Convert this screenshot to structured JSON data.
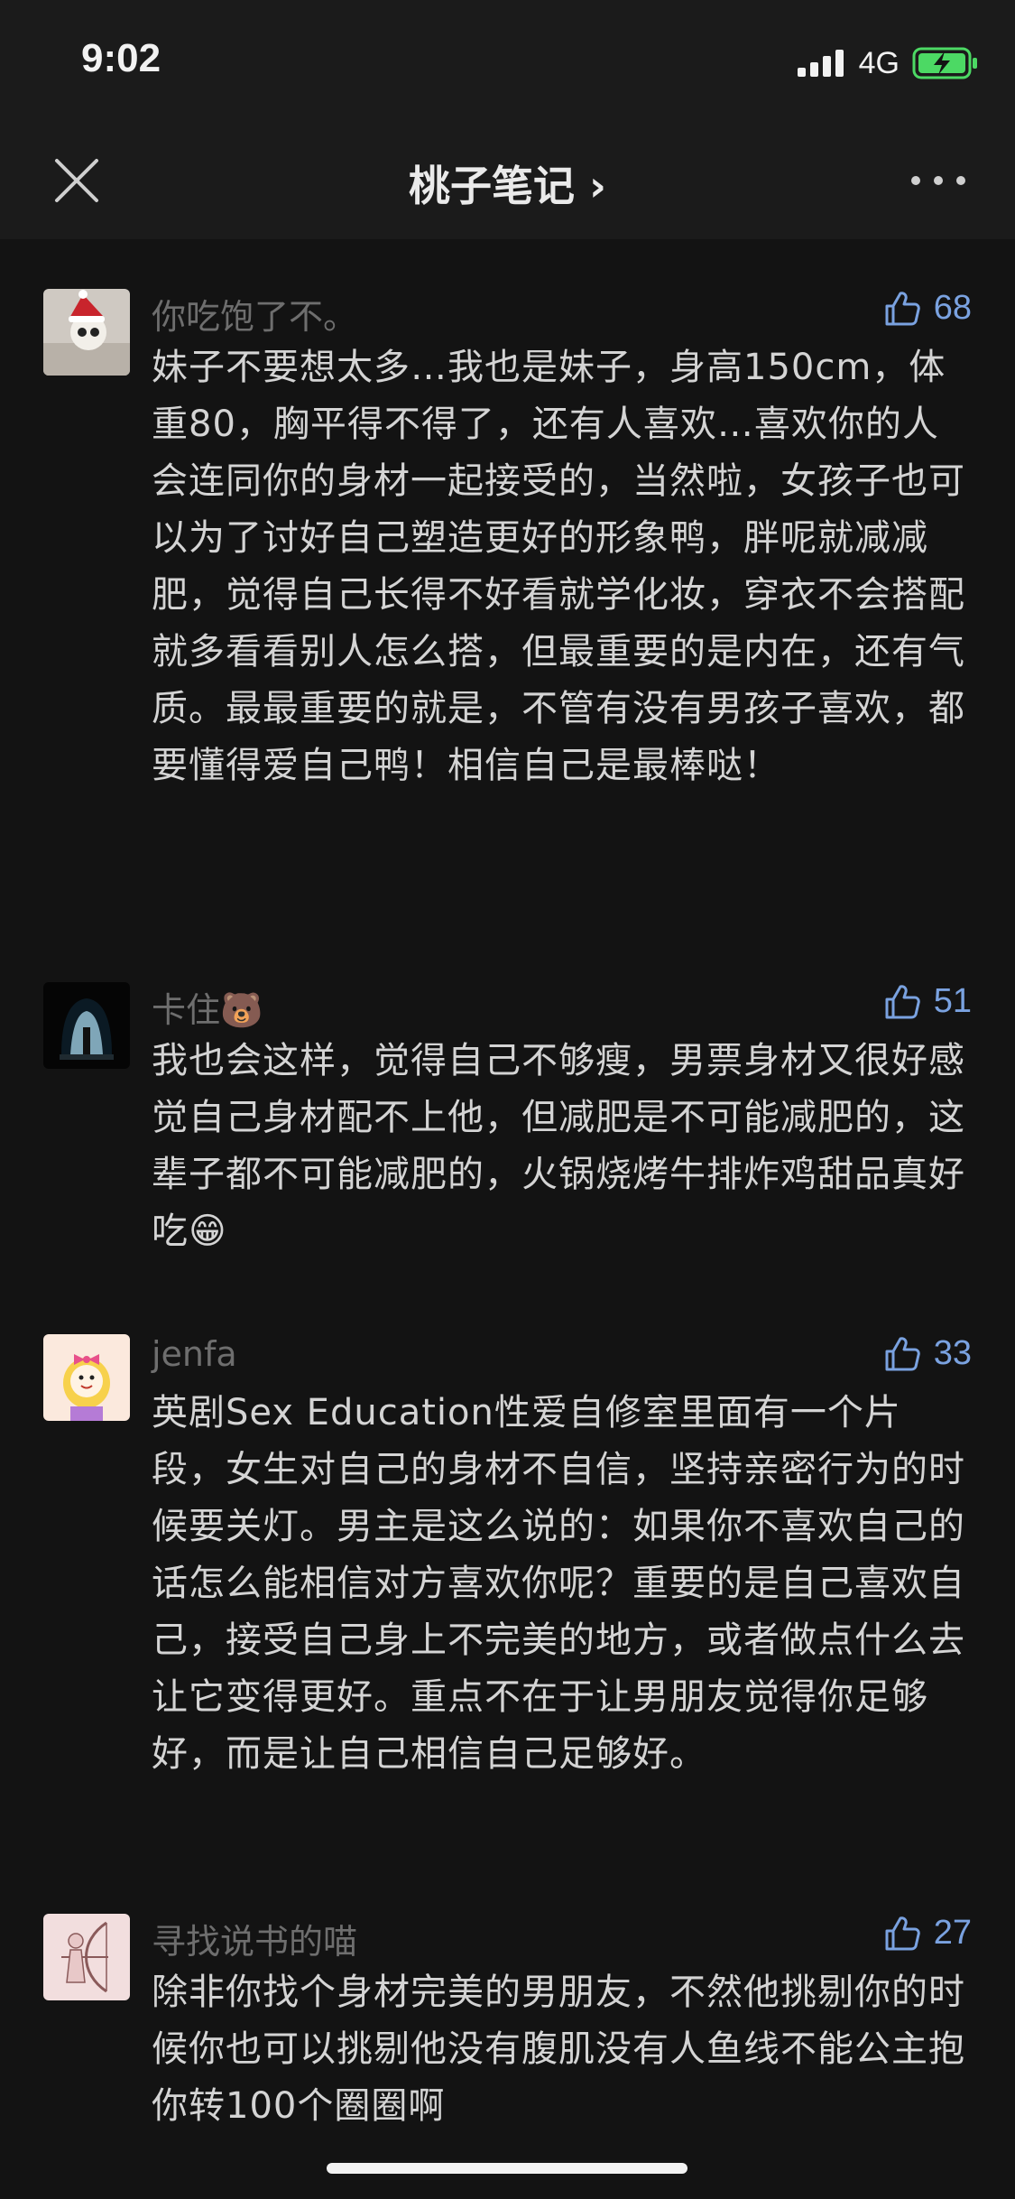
{
  "status": {
    "time": "9:02",
    "network": "4G"
  },
  "nav": {
    "title": "桃子笔记 ›"
  },
  "comments": [
    {
      "user": "你吃饱了不。",
      "likes": "68",
      "text": "妹子不要想太多…我也是妹子，身高150cm，体重80，胸平得不得了，还有人喜欢…喜欢你的人会连同你的身材一起接受的，当然啦，女孩子也可以为了讨好自己塑造更好的形象鸭，胖呢就减减肥，觉得自己长得不好看就学化妆，穿衣不会搭配就多看看别人怎么搭，但最重要的是内在，还有气质。最最重要的就是，不管有没有男孩子喜欢，都要懂得爱自己鸭！相信自己是最棒哒！"
    },
    {
      "user": "卡住🐻",
      "likes": "51",
      "text": "我也会这样，觉得自己不够瘦，男票身材又很好感觉自己身材配不上他，但减肥是不可能减肥的，这辈子都不可能减肥的，火锅烧烤牛排炸鸡甜品真好吃😁"
    },
    {
      "user": "jenfa",
      "likes": "33",
      "text": "英剧Sex Education性爱自修室里面有一个片段，女生对自己的身材不自信，坚持亲密行为的时候要关灯。男主是这么说的：如果你不喜欢自己的话怎么能相信对方喜欢你呢？重要的是自己喜欢自己，接受自己身上不完美的地方，或者做点什么去让它变得更好。重点不在于让男朋友觉得你足够好，而是让自己相信自己足够好。"
    },
    {
      "user": "寻找说书的喵",
      "likes": "27",
      "text": "除非你找个身材完美的男朋友，不然他挑剔你的时候你也可以挑剔他没有腹肌没有人鱼线不能公主抱你转100个圈圈啊"
    }
  ],
  "colors": {
    "like": "#7aa2e0",
    "battery": "#4cd964",
    "background": "#131313"
  }
}
